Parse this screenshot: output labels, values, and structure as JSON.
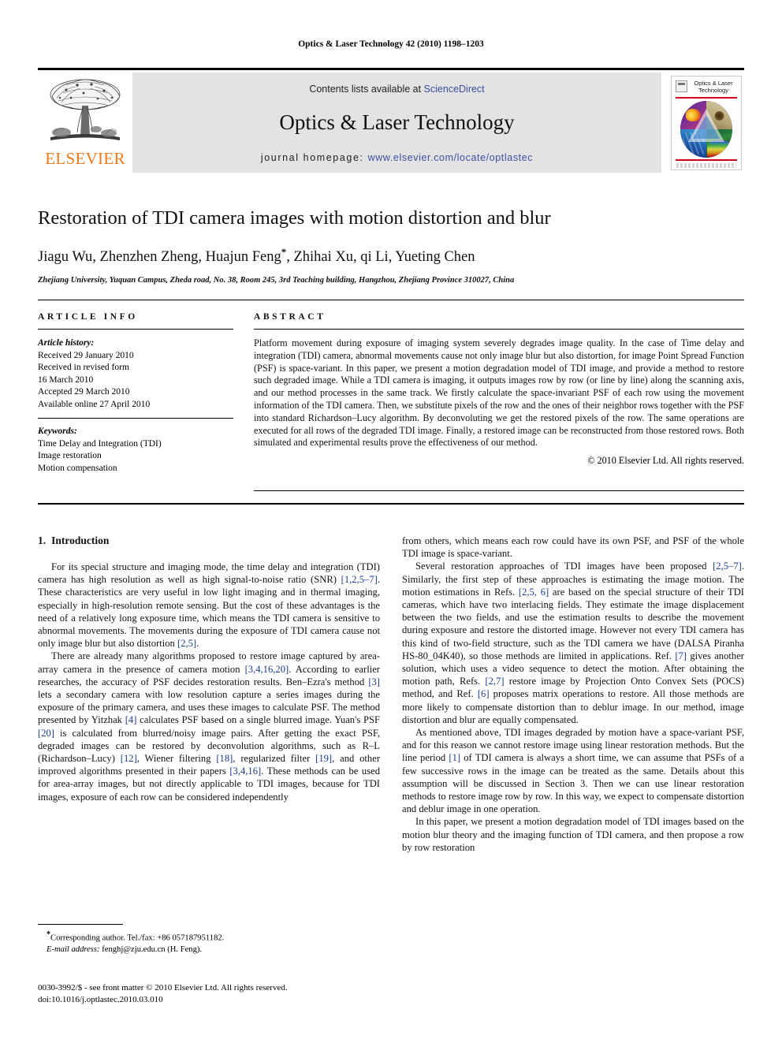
{
  "running_head": "Optics & Laser Technology 42 (2010) 1198–1203",
  "masthead": {
    "contents_prefix": "Contents lists available at ",
    "sciencedirect": "ScienceDirect",
    "journal_name": "Optics & Laser Technology",
    "homepage_label": "journal homepage: ",
    "homepage_url": "www.elsevier.com/locate/optlastec",
    "publisher_wordmark": "ELSEVIER",
    "cover_title": "Optics & Laser Technology",
    "link_color": "#3A4FA0",
    "wordmark_color": "#F07818",
    "band_color": "#E3E3E3"
  },
  "article": {
    "title": "Restoration of TDI camera images with motion distortion and blur",
    "authors": "Jiagu Wu, Zhenzhen Zheng, Huajun Feng",
    "authors_tail": ", Zhihai Xu, qi Li, Yueting Chen",
    "corresponding_marker": "*",
    "affiliation": "Zhejiang University, Yuquan Campus, Zheda road, No. 38, Room 245, 3rd Teaching building, Hangzhou, Zhejiang Province 310027, China"
  },
  "info": {
    "heading": "ARTICLE INFO",
    "history_label": "Article history:",
    "history": [
      "Received 29 January 2010",
      "Received in revised form",
      "16 March 2010",
      "Accepted 29 March 2010",
      "Available online 27 April 2010"
    ],
    "keywords_label": "Keywords:",
    "keywords": [
      "Time Delay and Integration (TDI)",
      "Image restoration",
      "Motion compensation"
    ]
  },
  "abstract": {
    "heading": "ABSTRACT",
    "text": "Platform movement during exposure of imaging system severely degrades image quality. In the case of Time delay and integration (TDI) camera, abnormal movements cause not only image blur but also distortion, for image Point Spread Function (PSF) is space-variant. In this paper, we present a motion degradation model of TDI image, and provide a method to restore such degraded image. While a TDI camera is imaging, it outputs images row by row (or line by line) along the scanning axis, and our method processes in the same track. We firstly calculate the space-invariant PSF of each row using the movement information of the TDI camera. Then, we substitute pixels of the row and the ones of their neighbor rows together with the PSF into standard Richardson–Lucy algorithm. By deconvoluting we get the restored pixels of the row. The same operations are executed for all rows of the degraded TDI image. Finally, a restored image can be reconstructed from those restored rows. Both simulated and experimental results prove the effectiveness of our method.",
    "copyright": "© 2010 Elsevier Ltd. All rights reserved."
  },
  "body": {
    "section_number": "1.",
    "section_title": "Introduction",
    "left_paragraphs": [
      {
        "segments": [
          {
            "t": "For its special structure and imaging mode, the time delay and integration (TDI) camera has high resolution as well as high signal-to-noise ratio (SNR) "
          },
          {
            "t": "[1,2,5–7]",
            "ref": true
          },
          {
            "t": ". These characteristics are very useful in low light imaging and in thermal imaging, especially in high-resolution remote sensing. But the cost of these advantages is the need of a relatively long exposure time, which means the TDI camera is sensitive to abnormal movements. The movements during the exposure of TDI camera cause not only image blur but also distortion "
          },
          {
            "t": "[2,5]",
            "ref": true
          },
          {
            "t": "."
          }
        ]
      },
      {
        "segments": [
          {
            "t": "There are already many algorithms proposed to restore image captured by area-array camera in the presence of camera motion "
          },
          {
            "t": "[3,4,16,20]",
            "ref": true
          },
          {
            "t": ". According to earlier researches, the accuracy of PSF decides restoration results. Ben–Ezra's method "
          },
          {
            "t": "[3]",
            "ref": true
          },
          {
            "t": " lets a secondary camera with low resolution capture a series images during the exposure of the primary camera, and uses these images to calculate PSF. The method presented by Yitzhak "
          },
          {
            "t": "[4]",
            "ref": true
          },
          {
            "t": " calculates PSF based on a single blurred image. Yuan's PSF "
          },
          {
            "t": "[20]",
            "ref": true
          },
          {
            "t": " is calculated from blurred/noisy image pairs. After getting the exact PSF, degraded images can be restored by deconvolution algorithms, such as R–L (Richardson–Lucy) "
          },
          {
            "t": "[12]",
            "ref": true
          },
          {
            "t": ", Wiener filtering "
          },
          {
            "t": "[18]",
            "ref": true
          },
          {
            "t": ", regularized filter "
          },
          {
            "t": "[19]",
            "ref": true
          },
          {
            "t": ", and other improved algorithms presented in their papers "
          },
          {
            "t": "[3,4,16]",
            "ref": true
          },
          {
            "t": ". These methods can be used for area-array images, but not directly applicable to TDI images, because for TDI images, exposure of each row can be considered independently"
          }
        ]
      }
    ],
    "right_paragraphs": [
      {
        "noindent": true,
        "segments": [
          {
            "t": "from others, which means each row could have its own PSF, and PSF of the whole TDI image is space-variant."
          }
        ]
      },
      {
        "segments": [
          {
            "t": "Several restoration approaches of TDI images have been proposed "
          },
          {
            "t": "[2,5–7]",
            "ref": true
          },
          {
            "t": ". Similarly, the first step of these approaches is estimating the image motion. The motion estimations in Refs. "
          },
          {
            "t": "[2,5, 6]",
            "ref": true
          },
          {
            "t": " are based on the special structure of their TDI cameras, which have two interlacing fields. They estimate the image displacement between the two fields, and use the estimation results to describe the movement during exposure and restore the distorted image. However not every TDI camera has this kind of two-field structure, such as the TDI camera we have (DALSA Piranha HS-80_04K40), so those methods are limited in applications. Ref. "
          },
          {
            "t": "[7]",
            "ref": true
          },
          {
            "t": " gives another solution, which uses a video sequence to detect the motion. After obtaining the motion path, Refs. "
          },
          {
            "t": "[2,7]",
            "ref": true
          },
          {
            "t": " restore image by Projection Onto Convex Sets (POCS) method, and Ref. "
          },
          {
            "t": "[6]",
            "ref": true
          },
          {
            "t": " proposes matrix operations to restore. All those methods are more likely to compensate distortion than to deblur image. In our method, image distortion and blur are equally compensated."
          }
        ]
      },
      {
        "segments": [
          {
            "t": "As mentioned above, TDI images degraded by motion have a space-variant PSF, and for this reason we cannot restore image using linear restoration methods. But the line period "
          },
          {
            "t": "[1]",
            "ref": true
          },
          {
            "t": " of TDI camera is always a short time, we can assume that PSFs of a few successive rows in the image can be treated as the same. Details about this assumption will be discussed in Section 3. Then we can use linear restoration methods to restore image row by row. In this way, we expect to compensate distortion and deblur image in one operation."
          }
        ]
      },
      {
        "segments": [
          {
            "t": "In this paper, we present a motion degradation model of TDI images based on the motion blur theory and the imaging function of TDI camera, and then propose a row by row restoration"
          }
        ]
      }
    ]
  },
  "footnote": {
    "star": "*",
    "corresponding": "Corresponding author. Tel./fax: +86 057187951182.",
    "email_label": "E-mail address:",
    "email": " fenghj@zju.edu.cn (H. Feng)."
  },
  "colophon": {
    "line1": "0030-3992/$ - see front matter © 2010 Elsevier Ltd. All rights reserved.",
    "line2": "doi:10.1016/j.optlastec.2010.03.010"
  }
}
